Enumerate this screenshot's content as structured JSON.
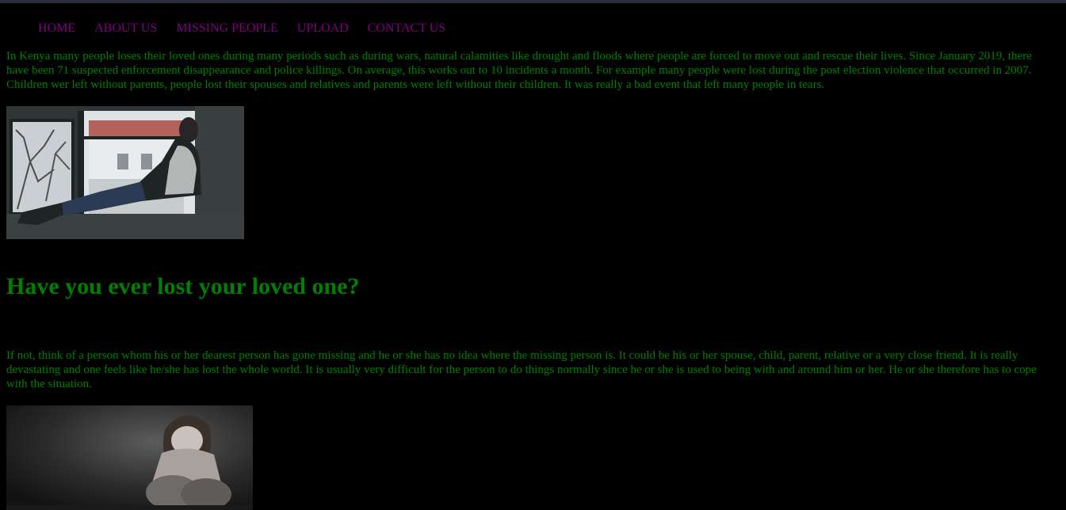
{
  "nav": {
    "items": [
      {
        "label": "HOME"
      },
      {
        "label": "ABOUT US"
      },
      {
        "label": "MISSING PEOPLE"
      },
      {
        "label": "UPLOAD"
      },
      {
        "label": "CONTACT US"
      }
    ]
  },
  "main": {
    "intro": "In Kenya many people loses their loved ones during many periods such as during wars, natural calamities like drought and floods where people are forced to move out and rescue their lives. Since January 2019, there have been 71 suspected enforcement disappearance and police killings. On average, this works out to 10 incidents a month. For example many people were lost during the post election violence that occurred in 2007. Children wer left without parents, people lost their spouses and relatives and parents were left without their children. It was really a bad event that left many people in tears.",
    "heading": "Have you ever lost your loved one?",
    "body": "If not, think of a person whom his or her dearest person has gone missing and he or she has no idea where the missing person is. It could be his or her spouse, child, parent, relative or a very close friend. It is really devastating and one feels like he/she has lost the whole world. It is usually very difficult for the person to do things normally since he or she is used to being with and around him or her. He or she therefore has to cope with the situation."
  },
  "colors": {
    "background": "#000000",
    "text": "#008000",
    "link": "#800080"
  }
}
